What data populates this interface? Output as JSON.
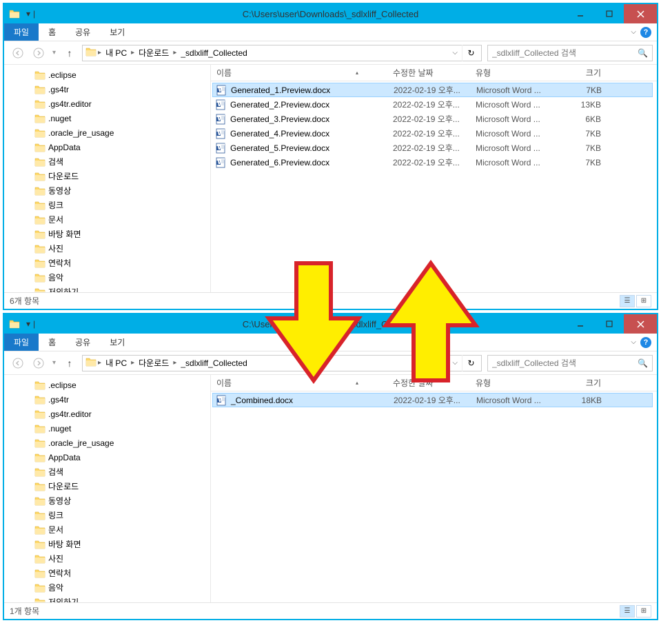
{
  "window1": {
    "title": "C:\\Users\\user\\Downloads\\_sdlxliff_Collected",
    "ribbon": {
      "file": "파일",
      "home": "홈",
      "share": "공유",
      "view": "보기"
    },
    "breadcrumbs": [
      "내 PC",
      "다운로드",
      "_sdlxliff_Collected"
    ],
    "search_placeholder": "_sdlxliff_Collected 검색",
    "columns": {
      "name": "이름",
      "date": "수정한 날짜",
      "type": "유형",
      "size": "크기"
    },
    "tree": [
      ".eclipse",
      ".gs4tr",
      ".gs4tr.editor",
      ".nuget",
      ".oracle_jre_usage",
      "AppData",
      "검색",
      "다운로드",
      "동영상",
      "링크",
      "문서",
      "바탕 화면",
      "사진",
      "연락처",
      "음악",
      "저의하기"
    ],
    "files": [
      {
        "name": "Generated_1.Preview.docx",
        "date": "2022-02-19 오후...",
        "type": "Microsoft Word ...",
        "size": "7KB",
        "selected": true
      },
      {
        "name": "Generated_2.Preview.docx",
        "date": "2022-02-19 오후...",
        "type": "Microsoft Word ...",
        "size": "13KB",
        "selected": false
      },
      {
        "name": "Generated_3.Preview.docx",
        "date": "2022-02-19 오후...",
        "type": "Microsoft Word ...",
        "size": "6KB",
        "selected": false
      },
      {
        "name": "Generated_4.Preview.docx",
        "date": "2022-02-19 오후...",
        "type": "Microsoft Word ...",
        "size": "7KB",
        "selected": false
      },
      {
        "name": "Generated_5.Preview.docx",
        "date": "2022-02-19 오후...",
        "type": "Microsoft Word ...",
        "size": "7KB",
        "selected": false
      },
      {
        "name": "Generated_6.Preview.docx",
        "date": "2022-02-19 오후...",
        "type": "Microsoft Word ...",
        "size": "7KB",
        "selected": false
      }
    ],
    "status": "6개 항목"
  },
  "window2": {
    "title": "C:\\Users\\user\\Downloads\\_sdlxliff_Collected",
    "ribbon": {
      "file": "파일",
      "home": "홈",
      "share": "공유",
      "view": "보기"
    },
    "breadcrumbs": [
      "내 PC",
      "다운로드",
      "_sdlxliff_Collected"
    ],
    "search_placeholder": "_sdlxliff_Collected 검색",
    "columns": {
      "name": "이름",
      "date": "수정한 날짜",
      "type": "유형",
      "size": "크기"
    },
    "tree": [
      ".eclipse",
      ".gs4tr",
      ".gs4tr.editor",
      ".nuget",
      ".oracle_jre_usage",
      "AppData",
      "검색",
      "다운로드",
      "동영상",
      "링크",
      "문서",
      "바탕 화면",
      "사진",
      "연락처",
      "음악",
      "저의하기"
    ],
    "files": [
      {
        "name": "_Combined.docx",
        "date": "2022-02-19 오후...",
        "type": "Microsoft Word ...",
        "size": "18KB",
        "selected": true
      }
    ],
    "status": "1개 항목"
  }
}
